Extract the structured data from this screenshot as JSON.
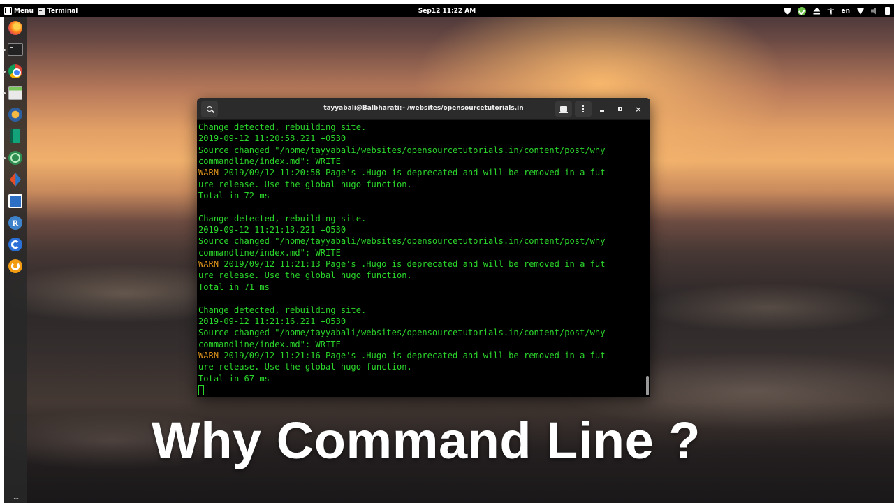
{
  "top_panel": {
    "menu_label": "Menu",
    "task_label": "Terminal",
    "clock": "Sep12 11:22 AM",
    "tray": {
      "keyboard_layout": "en",
      "icons": [
        "shield-icon",
        "update-check-icon",
        "eject-icon",
        "accessibility-icon",
        "wifi-icon",
        "volume-icon",
        "battery-icon"
      ]
    }
  },
  "dock": {
    "items": [
      {
        "name": "firefox",
        "icon": "firefox-icon",
        "running": false
      },
      {
        "name": "terminal",
        "icon": "terminal-icon",
        "running": true
      },
      {
        "name": "chrome",
        "icon": "chrome-icon",
        "running": true
      },
      {
        "name": "files",
        "icon": "files-icon",
        "running": true
      },
      {
        "name": "wm",
        "icon": "app-wm-icon",
        "running": false
      },
      {
        "name": "book",
        "icon": "book-icon",
        "running": false
      },
      {
        "name": "atom",
        "icon": "atom-icon",
        "running": true
      },
      {
        "name": "flow",
        "icon": "flow-icon",
        "running": false
      },
      {
        "name": "presentation",
        "icon": "presentation-icon",
        "running": false
      },
      {
        "name": "r",
        "icon": "r-icon",
        "letter": "R",
        "running": false
      },
      {
        "name": "simplenote",
        "icon": "simplenote-icon",
        "running": false
      },
      {
        "name": "g",
        "icon": "g-app-icon",
        "running": false
      }
    ],
    "bottom_label": "⋯"
  },
  "terminal": {
    "title": "tayyabali@Balbharati:~/websites/opensourcetutorials.in",
    "lines": [
      {
        "type": "normal",
        "text": "Change detected, rebuilding site."
      },
      {
        "type": "normal",
        "text": "2019-09-12 11:20:58.221 +0530"
      },
      {
        "type": "normal",
        "text": "Source changed \"/home/tayyabali/websites/opensourcetutorials.in/content/post/why"
      },
      {
        "type": "normal",
        "text": "commandline/index.md\": WRITE"
      },
      {
        "type": "warn",
        "prefix": "WARN",
        "text": " 2019/09/12 11:20:58 Page's .Hugo is deprecated and will be removed in a fut"
      },
      {
        "type": "normal",
        "text": "ure release. Use the global hugo function."
      },
      {
        "type": "normal",
        "text": "Total in 72 ms"
      },
      {
        "type": "normal",
        "text": ""
      },
      {
        "type": "normal",
        "text": "Change detected, rebuilding site."
      },
      {
        "type": "normal",
        "text": "2019-09-12 11:21:13.221 +0530"
      },
      {
        "type": "normal",
        "text": "Source changed \"/home/tayyabali/websites/opensourcetutorials.in/content/post/why"
      },
      {
        "type": "normal",
        "text": "commandline/index.md\": WRITE"
      },
      {
        "type": "warn",
        "prefix": "WARN",
        "text": " 2019/09/12 11:21:13 Page's .Hugo is deprecated and will be removed in a fut"
      },
      {
        "type": "normal",
        "text": "ure release. Use the global hugo function."
      },
      {
        "type": "normal",
        "text": "Total in 71 ms"
      },
      {
        "type": "normal",
        "text": ""
      },
      {
        "type": "normal",
        "text": "Change detected, rebuilding site."
      },
      {
        "type": "normal",
        "text": "2019-09-12 11:21:16.221 +0530"
      },
      {
        "type": "normal",
        "text": "Source changed \"/home/tayyabali/websites/opensourcetutorials.in/content/post/why"
      },
      {
        "type": "normal",
        "text": "commandline/index.md\": WRITE"
      },
      {
        "type": "warn",
        "prefix": "WARN",
        "text": " 2019/09/12 11:21:16 Page's .Hugo is deprecated and will be removed in a fut"
      },
      {
        "type": "normal",
        "text": "ure release. Use the global hugo function."
      },
      {
        "type": "normal",
        "text": "Total in 67 ms"
      }
    ],
    "colors": {
      "text": "#2bd62b",
      "warn": "#d78e1b",
      "background": "#000000",
      "header": "#2b2b2b"
    }
  },
  "caption": "Why Command Line ?"
}
